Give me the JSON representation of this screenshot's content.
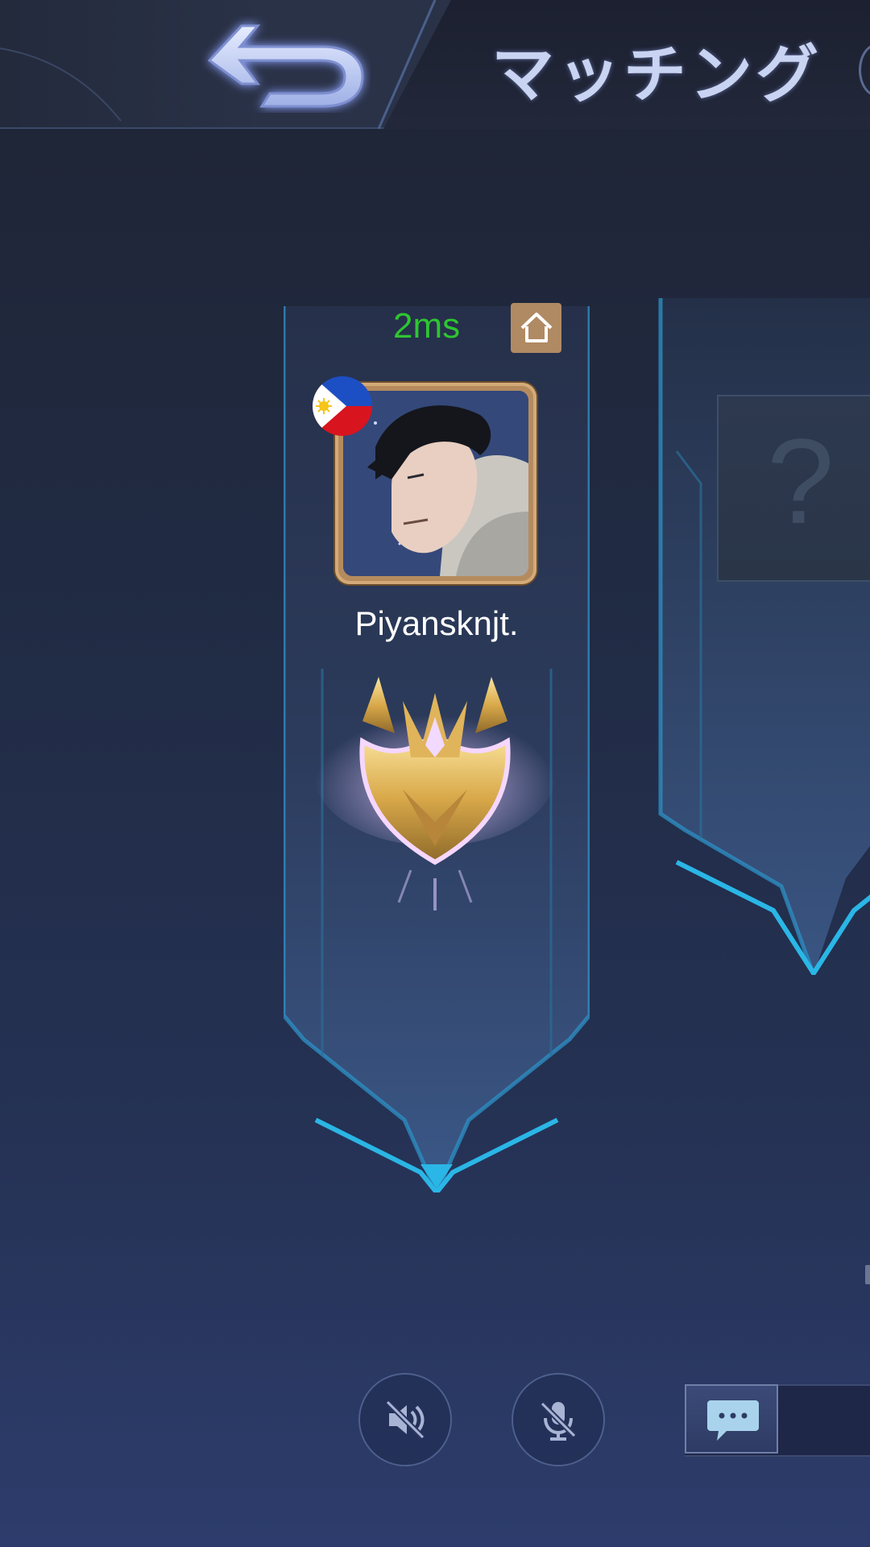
{
  "header": {
    "title": "マッチング",
    "back_icon": "back-arrow-icon"
  },
  "player": {
    "ping": "2ms",
    "ping_color": "#2ec531",
    "name": "Piyansknjt.",
    "flag": "philippines-flag-icon",
    "home_icon": "home-icon",
    "rank_icon": "rank-emblem-icon"
  },
  "empty_slot": {
    "icon": "question-mark-icon",
    "symbol": "?"
  },
  "controls": {
    "sound_icon": "speaker-muted-icon",
    "mic_icon": "mic-muted-icon",
    "chat_icon": "chat-bubble-icon"
  },
  "colors": {
    "accent_cyan": "#2ab6e6",
    "frame_gold": "#b58b5e",
    "home_button": "#b08a63"
  }
}
